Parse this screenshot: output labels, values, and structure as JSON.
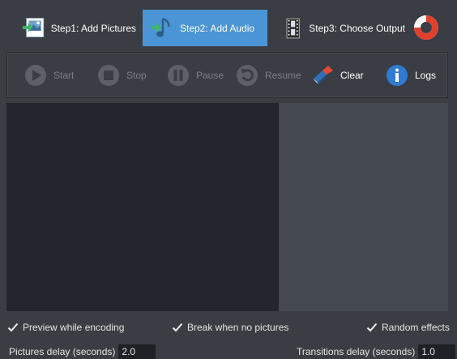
{
  "steps": [
    {
      "label": "Step1: Add Pictures",
      "icon": "add-pictures-icon"
    },
    {
      "label": "Step2: Add Audio",
      "icon": "add-audio-icon",
      "active": true
    },
    {
      "label": "Step3: Choose Output",
      "icon": "film-strip-icon"
    }
  ],
  "help_icon": "lifebuoy-icon",
  "toolbar": {
    "start": "Start",
    "stop": "Stop",
    "pause": "Pause",
    "resume": "Resume",
    "clear": "Clear",
    "logs": "Logs"
  },
  "options": {
    "preview_while_encoding": {
      "label": "Preview while encoding",
      "checked": true
    },
    "break_when_no_pictures": {
      "label": "Break when no pictures",
      "checked": true
    },
    "random_effects": {
      "label": "Random effects",
      "checked": true
    }
  },
  "delays": {
    "pictures_label": "Pictures delay (seconds)",
    "pictures_value": "2.0",
    "transitions_label": "Transitions delay (seconds)",
    "transitions_value": "1.0"
  },
  "colors": {
    "background": "#3a3d43",
    "active_step": "#4b95d6",
    "preview_area": "#24262d",
    "side_panel": "#444850"
  }
}
